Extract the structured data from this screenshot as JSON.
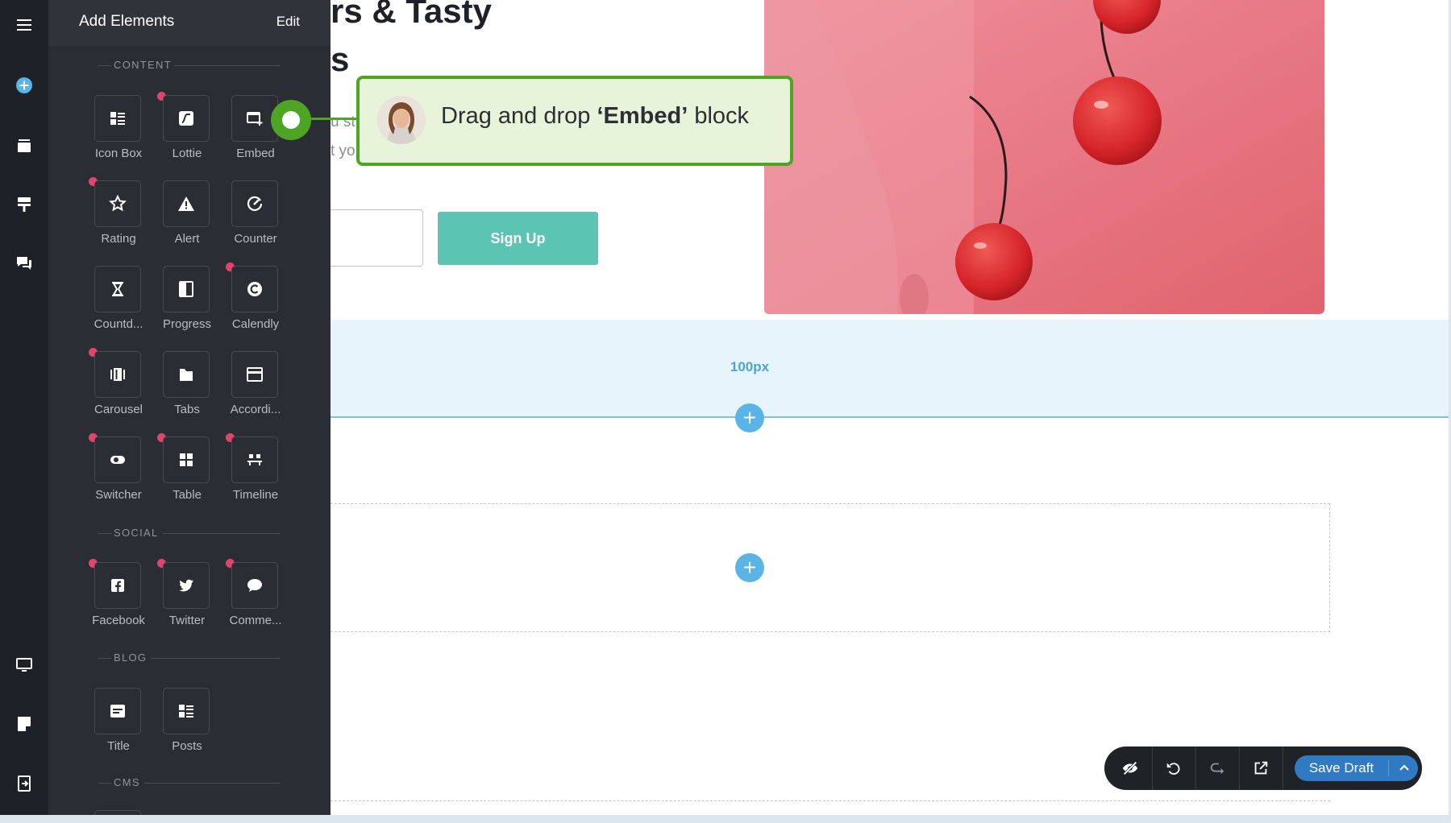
{
  "panel": {
    "title": "Add Elements",
    "edit_label": "Edit",
    "sections": {
      "content": "CONTENT",
      "social": "SOCIAL",
      "blog": "BLOG",
      "cms": "CMS"
    },
    "items": {
      "icon_box": "Icon Box",
      "lottie": "Lottie",
      "embed": "Embed",
      "rating": "Rating",
      "alert": "Alert",
      "counter": "Counter",
      "countdown": "Countd...",
      "progress": "Progress",
      "calendly": "Calendly",
      "carousel": "Carousel",
      "tabs": "Tabs",
      "accordion": "Accordi...",
      "switcher": "Switcher",
      "table": "Table",
      "timeline": "Timeline",
      "facebook": "Facebook",
      "twitter": "Twitter",
      "comments": "Comme...",
      "title": "Title",
      "posts": "Posts"
    }
  },
  "page": {
    "heading_line1": "rs & Tasty",
    "heading_line2": "s",
    "para_line1": "u st",
    "para_line2": "t yo",
    "signup_label": "Sign Up",
    "spacer_label": "100px"
  },
  "callout": {
    "text_before": "Drag and drop ",
    "text_bold": "‘Embed’",
    "text_after": " block"
  },
  "toolbar": {
    "save_draft_label": "Save Draft"
  },
  "colors": {
    "accent_green": "#4ea523",
    "signup_teal": "#5cc4b2",
    "save_blue": "#2f7ac2",
    "plus_blue": "#5ab4e5",
    "new_badge": "#e0456b"
  }
}
